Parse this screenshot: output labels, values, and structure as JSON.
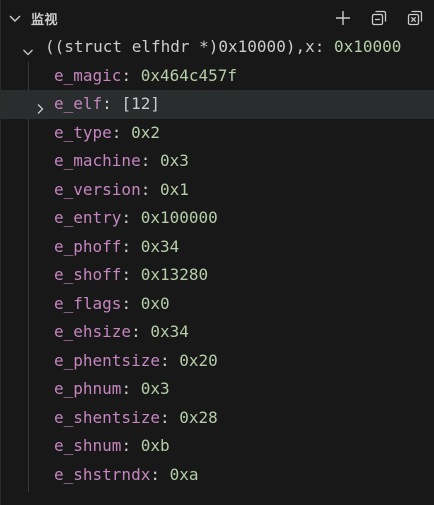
{
  "panel": {
    "title": "监视",
    "colors": {
      "background": "#181818",
      "property_name": "#c586c0",
      "number_value": "#b5cea8",
      "text": "#cccccc",
      "selected_row": "#2a2d2e"
    },
    "icons": {
      "collapse": "chevron-down-icon",
      "add": "add-icon",
      "collapse_all": "collapse-all-icon",
      "remove_all": "remove-all-icon"
    }
  },
  "watch": {
    "expression": "((struct elfhdr *)0x10000),x",
    "value": "0x10000",
    "children": [
      {
        "name": "e_magic",
        "value": "0x464c457f",
        "expandable": false
      },
      {
        "name": "e_elf",
        "value": "[12]",
        "expandable": true
      },
      {
        "name": "e_type",
        "value": "0x2",
        "expandable": false
      },
      {
        "name": "e_machine",
        "value": "0x3",
        "expandable": false
      },
      {
        "name": "e_version",
        "value": "0x1",
        "expandable": false
      },
      {
        "name": "e_entry",
        "value": "0x100000",
        "expandable": false
      },
      {
        "name": "e_phoff",
        "value": "0x34",
        "expandable": false
      },
      {
        "name": "e_shoff",
        "value": "0x13280",
        "expandable": false
      },
      {
        "name": "e_flags",
        "value": "0x0",
        "expandable": false
      },
      {
        "name": "e_ehsize",
        "value": "0x34",
        "expandable": false
      },
      {
        "name": "e_phentsize",
        "value": "0x20",
        "expandable": false
      },
      {
        "name": "e_phnum",
        "value": "0x3",
        "expandable": false
      },
      {
        "name": "e_shentsize",
        "value": "0x28",
        "expandable": false
      },
      {
        "name": "e_shnum",
        "value": "0xb",
        "expandable": false
      },
      {
        "name": "e_shstrndx",
        "value": "0xa",
        "expandable": false
      }
    ]
  }
}
